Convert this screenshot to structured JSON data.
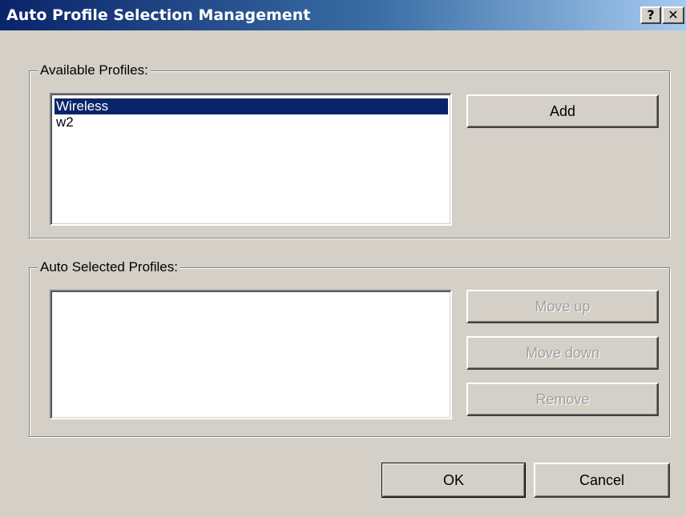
{
  "window": {
    "title": "Auto Profile Selection Management",
    "help_glyph": "?",
    "close_glyph": "✕"
  },
  "available": {
    "legend": "Available Profiles:",
    "items": [
      "Wireless",
      "w2"
    ],
    "selected_index": 0,
    "add_label": "Add"
  },
  "auto_selected": {
    "legend": "Auto Selected Profiles:",
    "items": [],
    "move_up_label": "Move up",
    "move_down_label": "Move down",
    "remove_label": "Remove"
  },
  "footer": {
    "ok_label": "OK",
    "cancel_label": "Cancel"
  },
  "colors": {
    "face": "#d4d0c8",
    "selection": "#0a246a",
    "title_start": "#0a246a",
    "title_end": "#a6caf0"
  },
  "icons": {
    "help": "help-question-icon",
    "close": "close-icon"
  }
}
